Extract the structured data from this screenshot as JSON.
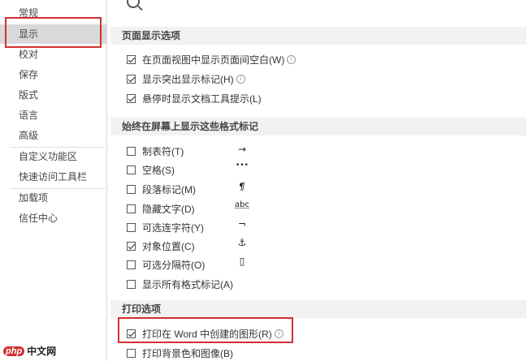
{
  "sidebar": {
    "items": [
      {
        "label": "常规"
      },
      {
        "label": "显示"
      },
      {
        "label": "校对"
      },
      {
        "label": "保存"
      },
      {
        "label": "版式"
      },
      {
        "label": "语言"
      },
      {
        "label": "高级"
      },
      {
        "label": "自定义功能区"
      },
      {
        "label": "快速访问工具栏"
      },
      {
        "label": "加载项"
      },
      {
        "label": "信任中心"
      }
    ]
  },
  "top_faded_text": "▔▔▔▔▔▔▔▔▔▔▔▔▔▔▔▔▔",
  "sections": {
    "page_display": {
      "title": "页面显示选项",
      "options": [
        {
          "label": "在页面视图中显示页面间空白(W)",
          "checked": true
        },
        {
          "label": "显示突出显示标记(H)",
          "checked": true
        },
        {
          "label": "悬停时显示文档工具提示(L)",
          "checked": true
        }
      ]
    },
    "formatting_marks": {
      "title": "始终在屏幕上显示这些格式标记",
      "options": [
        {
          "label": "制表符(T)",
          "checked": false,
          "glyph": "→"
        },
        {
          "label": "空格(S)",
          "checked": false,
          "glyph": "•••"
        },
        {
          "label": "段落标记(M)",
          "checked": false,
          "glyph": "¶"
        },
        {
          "label": "隐藏文字(D)",
          "checked": false,
          "glyph": "abc"
        },
        {
          "label": "可选连字符(Y)",
          "checked": false,
          "glyph": "¬"
        },
        {
          "label": "对象位置(C)",
          "checked": true,
          "glyph": "⚓"
        },
        {
          "label": "可选分隔符(O)",
          "checked": false,
          "glyph": "▯"
        },
        {
          "label": "显示所有格式标记(A)",
          "checked": false
        }
      ]
    },
    "print": {
      "title": "打印选项",
      "options": [
        {
          "label": "打印在 Word 中创建的图形(R)",
          "checked": true
        },
        {
          "label": "打印背景色和图像(B)",
          "checked": false
        }
      ]
    }
  },
  "watermark": {
    "logo": "php",
    "text": "中文网"
  }
}
